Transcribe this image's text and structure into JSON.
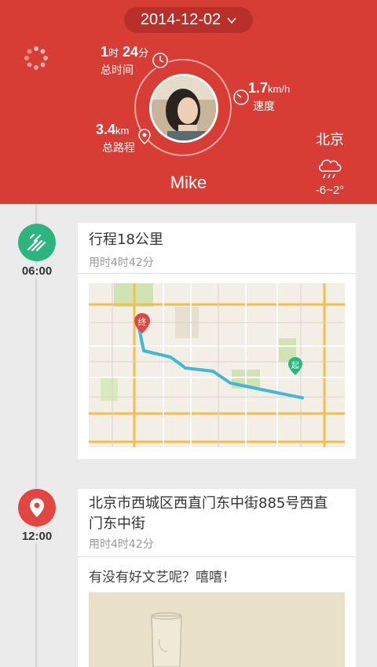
{
  "header": {
    "date": "2014-12-02",
    "username": "Mike",
    "stats": {
      "time": {
        "hours": "1",
        "hours_unit": "时",
        "minutes": "24",
        "minutes_unit": "分",
        "label": "总时间"
      },
      "speed": {
        "value": "1.7",
        "unit": "km/h",
        "label": "速度"
      },
      "distance": {
        "value": "3.4",
        "unit": "km",
        "label": "总路程"
      }
    },
    "weather": {
      "city": "北京",
      "temp": "-6~2°",
      "icon": "cloud-rain-icon"
    }
  },
  "timeline": [
    {
      "time": "06:00",
      "icon": "walking-route-icon",
      "title": "行程18公里",
      "subtitle": "用时4时42分",
      "map_markers": {
        "start": "起",
        "end": "终"
      }
    },
    {
      "time": "12:00",
      "icon": "location-pin-icon",
      "title": "北京市西城区西直门东中街885号西直门东中街",
      "subtitle": "用时4时42分",
      "note": "有没有好文艺呢？嘻嘻！"
    }
  ],
  "colors": {
    "primary_red": "#d83d35",
    "green": "#2cb57e",
    "route": "#41b8d9"
  }
}
